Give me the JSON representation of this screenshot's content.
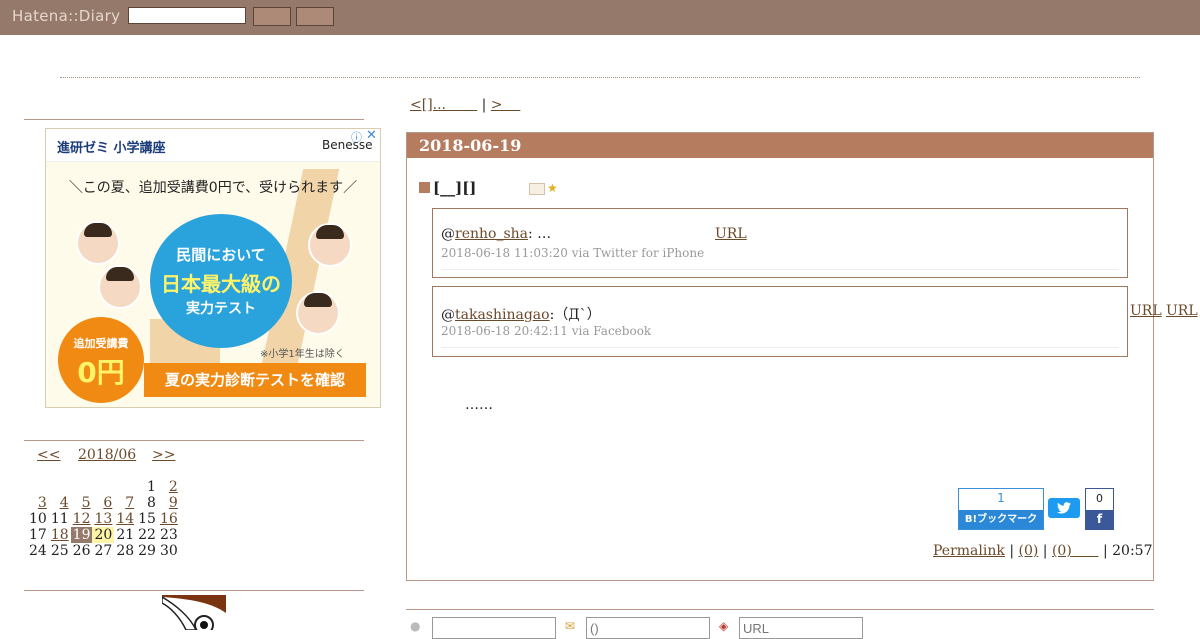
{
  "header": {
    "logo": "Hatena::Diary",
    "search_value": "",
    "button1_label": "",
    "button2_label": ""
  },
  "ad": {
    "title": "進研ゼミ 小学講座",
    "brand": "Benesse",
    "info_icon": "info-icon",
    "close_icon": "close-icon",
    "slogan": "＼この夏、追加受講費0円で、受けられます／",
    "circle_line1": "民間において",
    "circle_line2": "日本最大級の",
    "circle_line3": "実力テスト",
    "note": "※小学1年生は除く",
    "badge_line1": "追加受講費",
    "badge_line2": "0円",
    "cta": "夏の実力診断テストを確認"
  },
  "calendar": {
    "prev": "<<",
    "month": "2018/06",
    "next": ">>",
    "weeks": [
      [
        "",
        "",
        "",
        "",
        "",
        "1",
        "2"
      ],
      [
        "3",
        "4",
        "5",
        "6",
        "7",
        "8",
        "9"
      ],
      [
        "10",
        "11",
        "12",
        "13",
        "14",
        "15",
        "16"
      ],
      [
        "17",
        "18",
        "19",
        "20",
        "21",
        "22",
        "23"
      ],
      [
        "24",
        "25",
        "26",
        "27",
        "28",
        "29",
        "30"
      ]
    ],
    "linked_days": [
      "2",
      "3",
      "4",
      "5",
      "6",
      "7",
      "9",
      "12",
      "13",
      "14",
      "16",
      "18"
    ],
    "current_day": "19",
    "highlight_day": "20"
  },
  "pager": {
    "prev_label": "<[]...",
    "separator": "|",
    "next_label": ">"
  },
  "entry": {
    "date": "2018-06-19",
    "section_title": "[__][]",
    "quotes": [
      {
        "prefix": "@",
        "user": "renho_sha",
        "text": ": …",
        "links": [
          "URL"
        ],
        "meta": "2018-06-18 11:03:20 via Twitter for iPhone"
      },
      {
        "prefix": "@",
        "user": "takashinagao",
        "text": ":（Д`）",
        "links": [
          "URL",
          "URL"
        ],
        "meta": "2018-06-18 20:42:11 via Facebook"
      }
    ],
    "body_text": "……",
    "hatena_count": "1",
    "hatena_label": "B!ブックマーク",
    "twitter_icon": "twitter-icon",
    "facebook_count": "0",
    "facebook_icon": "facebook-icon",
    "footer": {
      "permalink": "Permalink",
      "sep": "|",
      "comments": "(0)",
      "trackbacks": "(0)",
      "time": "20:57"
    }
  },
  "comment_form": {
    "name_placeholder": "",
    "mail_placeholder": "()",
    "url_placeholder": "URL"
  },
  "colors": {
    "header_bg": "#957a6b",
    "date_bar": "#b57c5f",
    "link": "#6b4a2a"
  }
}
